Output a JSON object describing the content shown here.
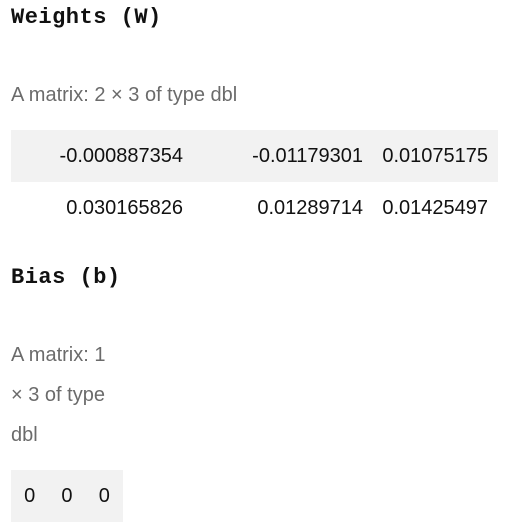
{
  "weights": {
    "heading": "Weights (W)",
    "caption": "A matrix: 2 × 3 of type dbl",
    "rows": [
      [
        "-0.000887354",
        "-0.01179301",
        "0.01075175"
      ],
      [
        "0.030165826",
        "0.01289714",
        "0.01425497"
      ]
    ]
  },
  "bias": {
    "heading": "Bias (b)",
    "caption": "A matrix: 1 × 3 of type dbl",
    "rows": [
      [
        "0",
        "0",
        "0"
      ]
    ]
  }
}
